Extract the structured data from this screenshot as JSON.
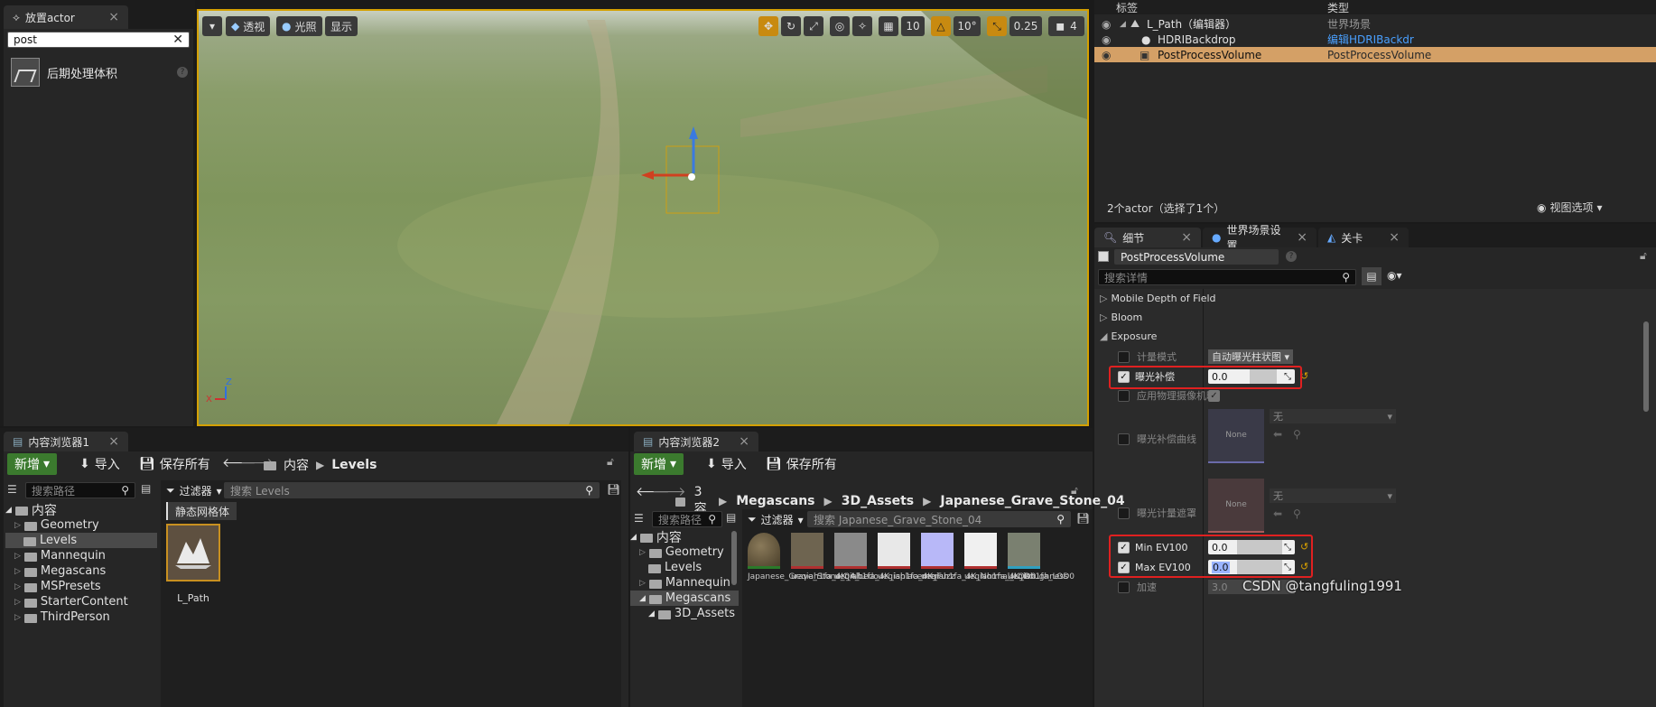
{
  "place_actor": {
    "tab_label": "放置actor",
    "search_value": "post",
    "result_label": "后期处理体积"
  },
  "viewport": {
    "perspective_label": "透视",
    "lit_label": "光照",
    "show_label": "显示",
    "grid_snap": "10",
    "rotation_snap": "10°",
    "scale_snap": "0.25",
    "camera_speed": "4"
  },
  "outliner": {
    "col_label": "标签",
    "col_type": "类型",
    "rows": [
      {
        "label": "L_Path（编辑器）",
        "type": "世界场景"
      },
      {
        "label": "HDRIBackdrop",
        "type": "编辑HDRIBackdr"
      },
      {
        "label": "PostProcessVolume",
        "type": "PostProcessVolume"
      }
    ],
    "status": "2个actor（选择了1个）",
    "view_options": "视图选项"
  },
  "details": {
    "tabs": [
      "细节",
      "世界场景设置",
      "关卡"
    ],
    "object_name": "PostProcessVolume",
    "search_placeholder": "搜索详情",
    "sections": [
      "Mobile Depth of Field",
      "Bloom",
      "Exposure"
    ],
    "props": {
      "metering_mode_label": "计量模式",
      "metering_mode_value": "自动曝光柱状图",
      "exposure_comp_label": "曝光补偿",
      "exposure_comp_value": "0.0",
      "physical_camera_label": "应用物理摄像机曝",
      "comp_curve_label": "曝光补偿曲线",
      "comp_curve_value": "无",
      "comp_curve_thumb": "None",
      "meter_mask_label": "曝光计量遮罩",
      "meter_mask_value": "无",
      "meter_mask_thumb": "None",
      "min_ev_label": "Min EV100",
      "min_ev_value": "0.0",
      "max_ev_label": "Max EV100",
      "max_ev_value": "0.0",
      "speed_label": "加速",
      "speed_value": "3.0"
    }
  },
  "cb1": {
    "tab_label": "内容浏览器1",
    "new_label": "新增",
    "import_label": "导入",
    "save_all_label": "保存所有",
    "crumbs": [
      "内容",
      "Levels"
    ],
    "search_paths_placeholder": "搜索路径",
    "filter_label": "过滤器",
    "search_assets_placeholder": "搜索 Levels",
    "tree": [
      "内容",
      "Geometry",
      "Levels",
      "Mannequin",
      "Megascans",
      "MSPresets",
      "StarterContent",
      "ThirdPerson"
    ],
    "chip": "静态网格体",
    "asset_label": "L_Path"
  },
  "cb2": {
    "tab_label": "内容浏览器2",
    "new_label": "新增",
    "import_label": "导入",
    "save_all_label": "保存所有",
    "crumbs": [
      "3容",
      "Megascans",
      "3D_Assets",
      "Japanese_Grave_Stone_04"
    ],
    "search_paths_placeholder": "搜索路径",
    "filter_label": "过滤器",
    "search_assets_placeholder": "搜索 Japanese_Grave_Stone_04",
    "tree": [
      "内容",
      "Geometry",
      "Levels",
      "Mannequin",
      "Megascans",
      "3D_Assets"
    ],
    "assets": [
      "Japanese_Grave_Stone_04_...",
      "ueqiah1fa_4K_Albedo",
      "ueqiah1fa_4K_isplacemer",
      "ueqiah1fa_4K_Fuzz",
      "ueqiah1fa_4K_Normal_LOD0",
      "ueqiah1fa_4K_Roughness",
      "ueqiah1fa_LOD0"
    ]
  },
  "watermark": "CSDN @tangfuling1991"
}
